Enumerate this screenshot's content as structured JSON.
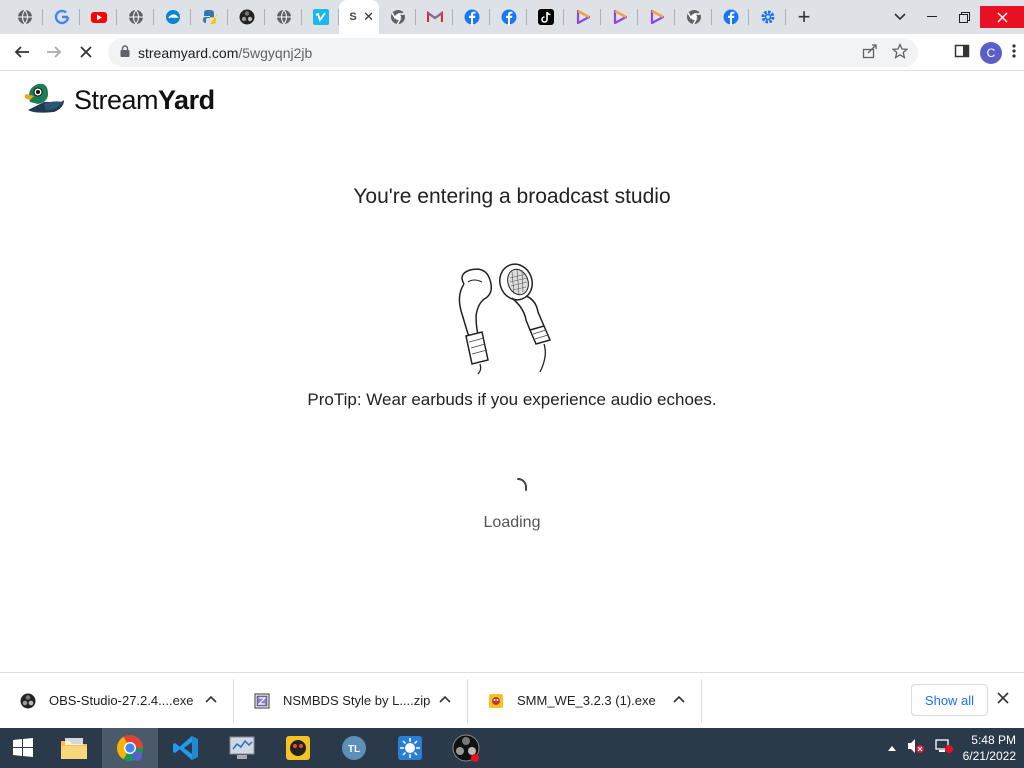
{
  "browser": {
    "tabs": [
      {
        "icon": "globe-icon",
        "color": "#5f6368"
      },
      {
        "icon": "google-icon",
        "color": "#4285f4"
      },
      {
        "icon": "youtube-icon",
        "color": "#ff0000"
      },
      {
        "icon": "globe-icon",
        "color": "#5f6368"
      },
      {
        "icon": "edge-icon",
        "color": "#0a84d0"
      },
      {
        "icon": "python-icon",
        "color": "#3776ab"
      },
      {
        "icon": "obs-icon",
        "color": "#222222"
      },
      {
        "icon": "globe-icon",
        "color": "#5f6368"
      },
      {
        "icon": "vimeo-icon",
        "color": "#1ab7ea"
      }
    ],
    "active_tab": {
      "favicon_text": "S",
      "close": "✕"
    },
    "tabs_after": [
      {
        "icon": "chrome-icon",
        "color": "#5f6368"
      },
      {
        "icon": "gmail-icon",
        "color": "#d93025"
      },
      {
        "icon": "facebook-icon",
        "color": "#1877f2"
      },
      {
        "icon": "facebook-icon",
        "color": "#1877f2"
      },
      {
        "icon": "tiktok-icon",
        "color": "#000000"
      },
      {
        "icon": "play-icon",
        "color": "#8e44ef"
      },
      {
        "icon": "play-icon",
        "color": "#8e44ef"
      },
      {
        "icon": "play-icon",
        "color": "#8e44ef"
      },
      {
        "icon": "chrome-icon",
        "color": "#5f6368"
      },
      {
        "icon": "facebook-icon",
        "color": "#1877f2"
      },
      {
        "icon": "gear-icon",
        "color": "#1a73e8"
      }
    ],
    "new_tab": "+",
    "url_host": "streamyard.com",
    "url_path": "/5wgyqnj2jb",
    "profile_initial": "C"
  },
  "page": {
    "logo_light": "Stream",
    "logo_bold": "Yard",
    "headline": "You're entering a broadcast studio",
    "protip": "ProTip: Wear earbuds if you experience audio echoes.",
    "loading": "Loading"
  },
  "downloads": {
    "items": [
      {
        "name": "OBS-Studio-27.2.4....exe",
        "icon": "obs-icon"
      },
      {
        "name": "NSMBDS Style by L....zip",
        "icon": "zip-icon"
      },
      {
        "name": "SMM_WE_3.2.3 (1).exe",
        "icon": "smm-icon"
      }
    ],
    "show_all": "Show all"
  },
  "taskbar": {
    "time": "5:48 PM",
    "date": "6/21/2022"
  },
  "colors": {
    "accent": "#1a73e8",
    "close_red": "#e81123",
    "taskbar": "#2b3a4a"
  }
}
